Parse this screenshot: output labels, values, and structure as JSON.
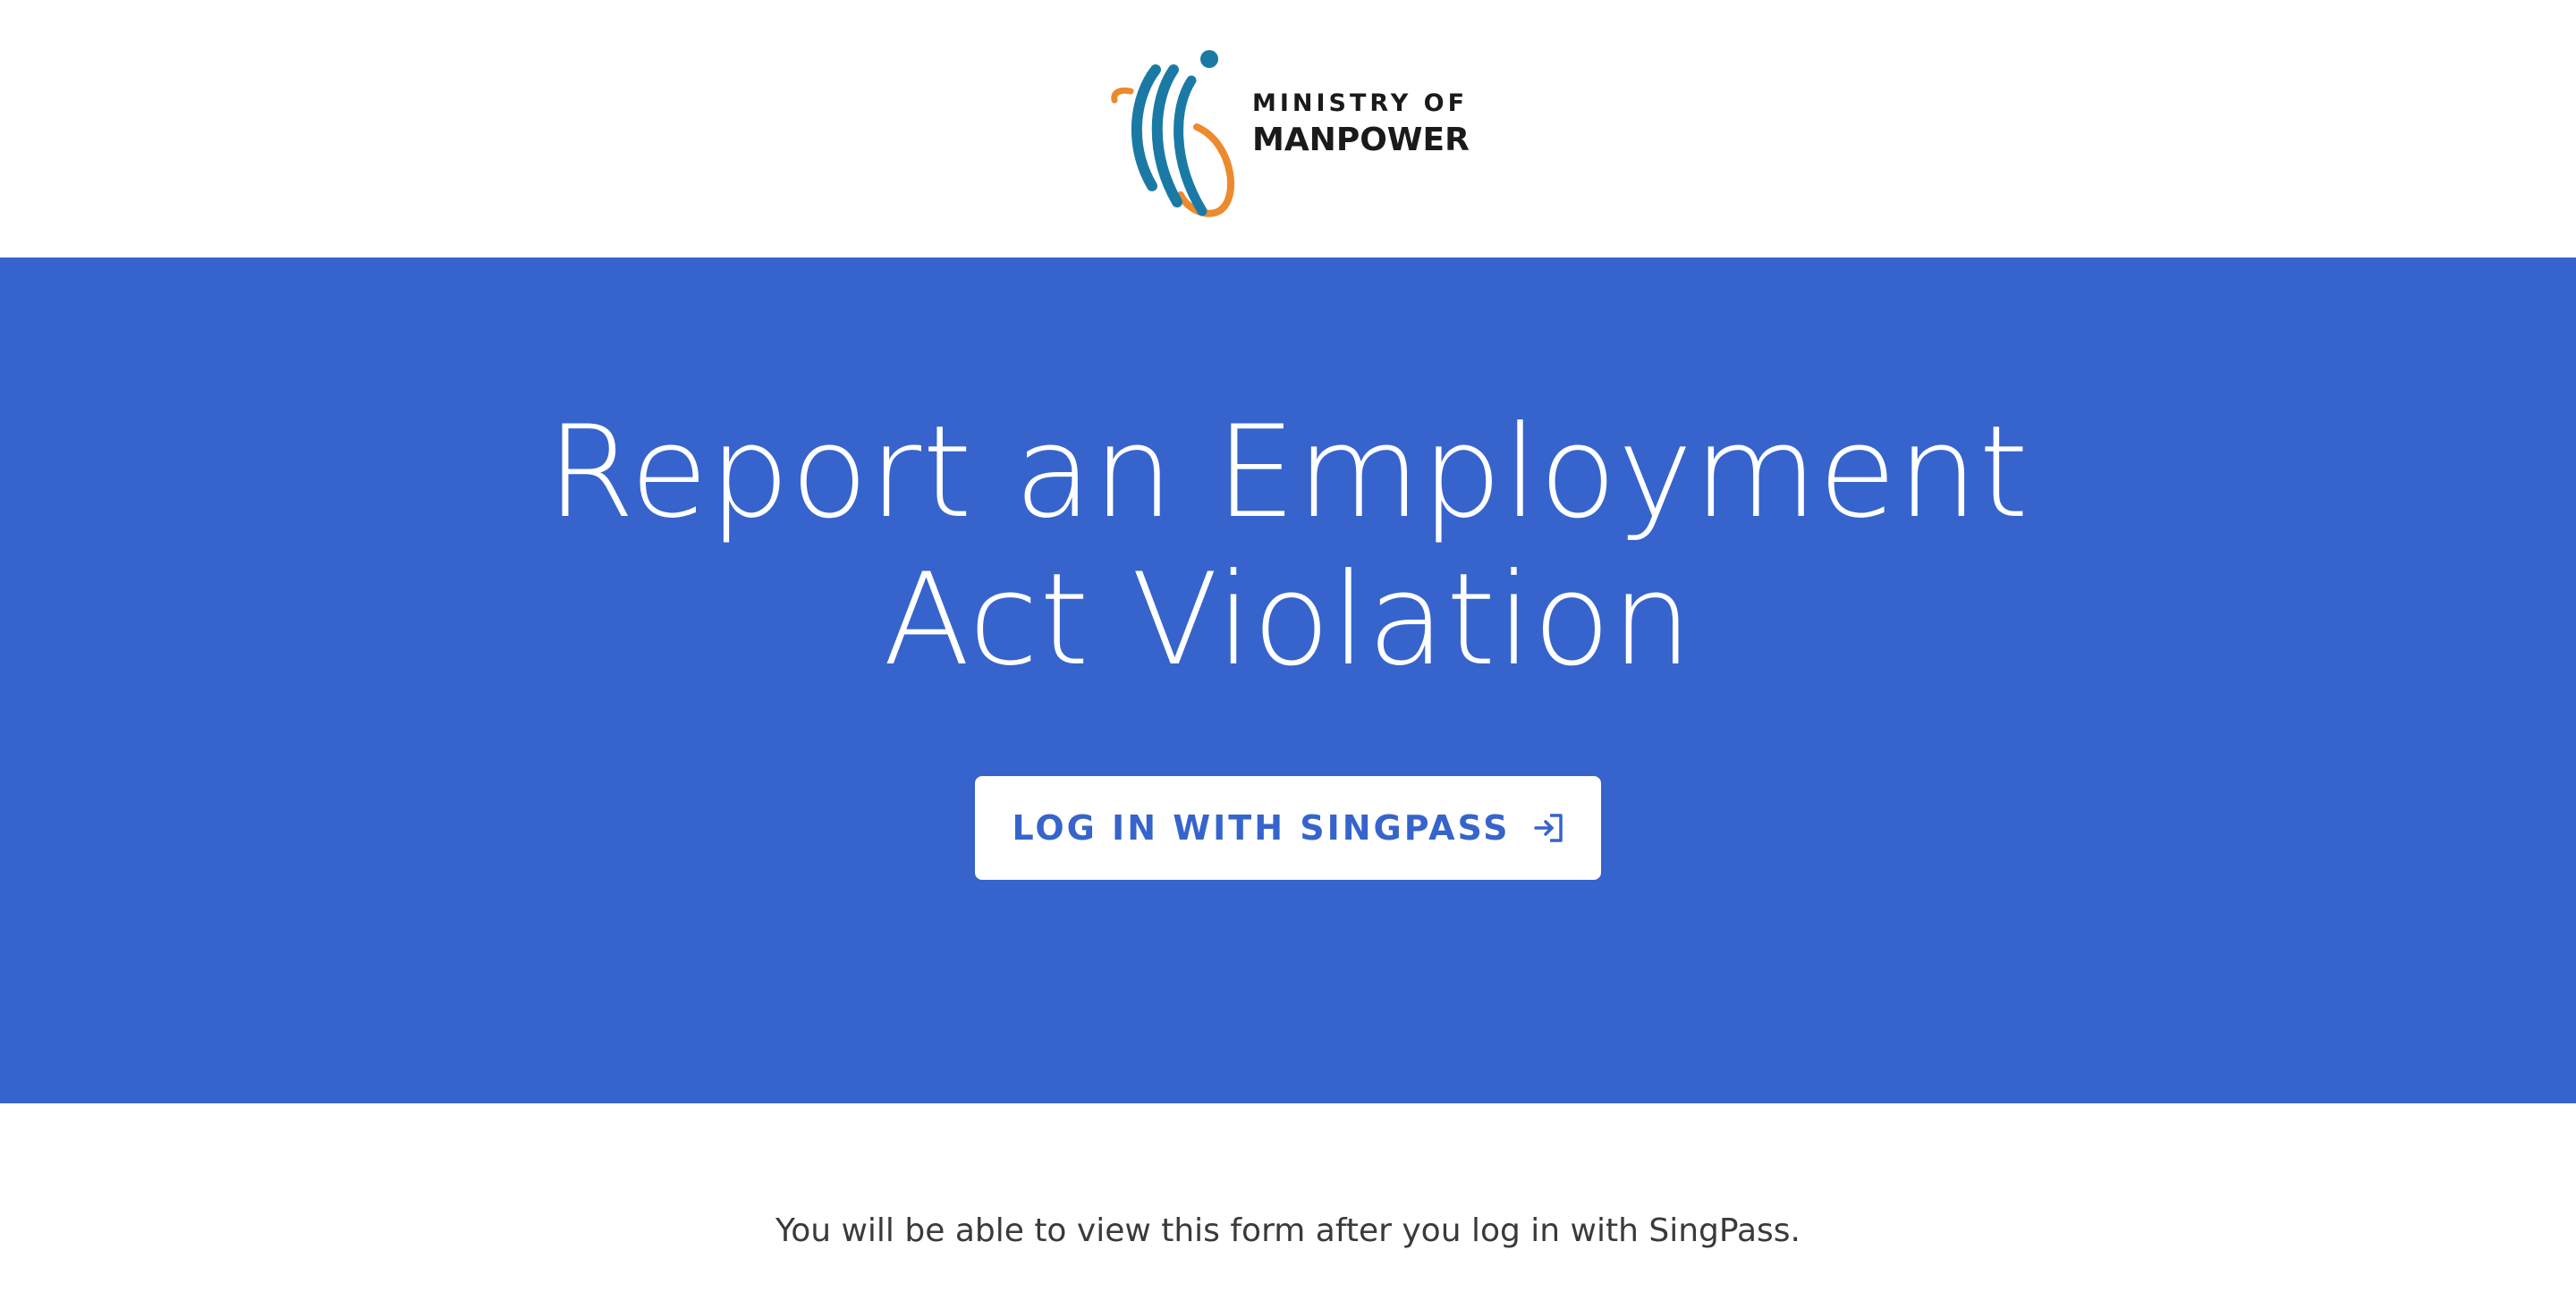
{
  "header": {
    "logo": {
      "line1": "MINISTRY OF",
      "line2": "MANPOWER"
    }
  },
  "hero": {
    "title_line1": "Report an Employment",
    "title_line2": "Act Violation",
    "button_label": "LOG IN WITH SINGPASS",
    "button_icon": "log-in-icon"
  },
  "note": {
    "text": "You will be able to view this form after you log in with SingPass."
  },
  "colors": {
    "hero_background": "#3664cc",
    "logo_blue": "#1b7aa5",
    "logo_orange": "#ec8a2d",
    "text_dark": "#3a3a3a"
  }
}
